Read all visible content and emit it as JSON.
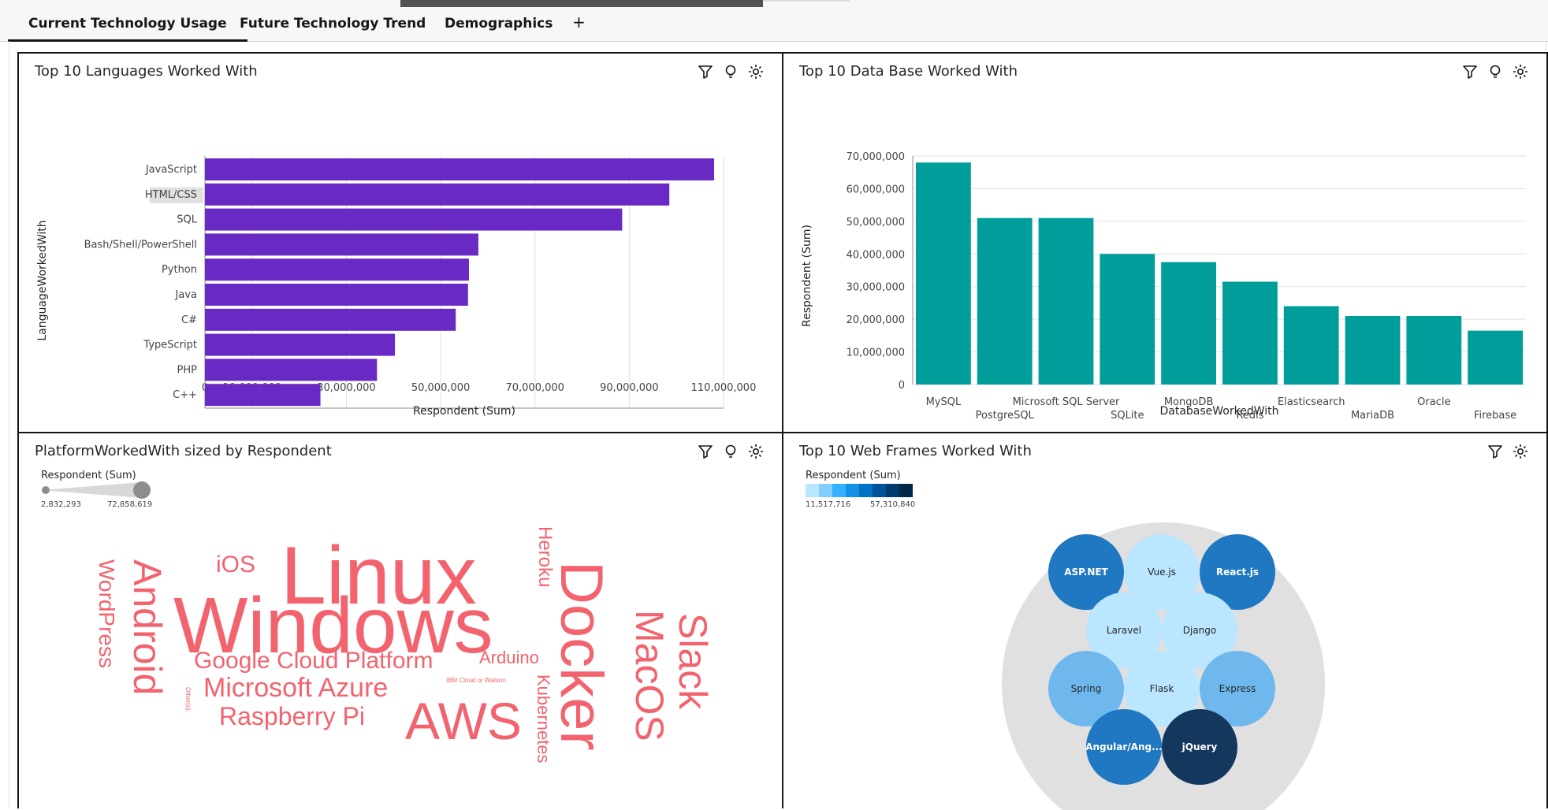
{
  "tabs": [
    {
      "label": "Current Technology Usage",
      "active": true
    },
    {
      "label": "Future Technology Trend",
      "active": false
    },
    {
      "label": "Demographics",
      "active": false
    }
  ],
  "add_tab_label": "+",
  "panels": {
    "languages": {
      "title": "Top 10 Languages Worked With"
    },
    "databases": {
      "title": "Top 10 Data Base Worked With"
    },
    "platforms": {
      "title": "PlatformWorkedWith sized by Respondent"
    },
    "webframes": {
      "title": "Top 10 Web Frames Worked With"
    }
  },
  "colors": {
    "bar_purple": "#6929c4",
    "bar_teal": "#009d9a",
    "wordcloud": "#f2636e"
  },
  "chart_data": [
    {
      "id": "languages",
      "type": "bar",
      "orientation": "horizontal",
      "title": "Top 10 Languages Worked With",
      "xlabel": "Respondent (Sum)",
      "ylabel": "LanguageWorkedWith",
      "categories": [
        "JavaScript",
        "HTML/CSS",
        "SQL",
        "Bash/Shell/PowerShell",
        "Python",
        "Java",
        "C#",
        "TypeScript",
        "PHP",
        "C++"
      ],
      "values": [
        108000000,
        98500000,
        88500000,
        58000000,
        56000000,
        55800000,
        53200000,
        40300000,
        36500000,
        24500000
      ],
      "xticks": [
        "0",
        "10,000,000",
        "30,000,000",
        "50,000,000",
        "70,000,000",
        "90,000,000",
        "110,000,000"
      ],
      "xtick_values": [
        0,
        10000000,
        30000000,
        50000000,
        70000000,
        90000000,
        110000000
      ],
      "xlim": [
        0,
        110000000
      ],
      "highlighted_category": "HTML/CSS",
      "grid": true
    },
    {
      "id": "databases",
      "type": "bar",
      "orientation": "vertical",
      "title": "Top 10 Data Base Worked With",
      "xlabel": "DatabaseWorkedWith",
      "ylabel": "Respondent (Sum)",
      "categories": [
        "MySQL",
        "PostgreSQL",
        "Microsoft SQL Server",
        "SQLite",
        "MongoDB",
        "Redis",
        "Elasticsearch",
        "MariaDB",
        "Oracle",
        "Firebase"
      ],
      "values": [
        68000000,
        51000000,
        51000000,
        40000000,
        37500000,
        31500000,
        24000000,
        21000000,
        21000000,
        16500000
      ],
      "yticks": [
        "0",
        "10,000,000",
        "20,000,000",
        "30,000,000",
        "40,000,000",
        "50,000,000",
        "60,000,000",
        "70,000,000"
      ],
      "ytick_values": [
        0,
        10000000,
        20000000,
        30000000,
        40000000,
        50000000,
        60000000,
        70000000
      ],
      "ylim": [
        0,
        70000000
      ],
      "grid": true
    },
    {
      "id": "platforms",
      "type": "wordcloud",
      "title": "PlatformWorkedWith sized by Respondent",
      "legend": {
        "title": "Respondent (Sum)",
        "min_label": "2,832,293",
        "max_label": "72,858,619"
      },
      "words": [
        {
          "text": "Linux",
          "value": 66000000
        },
        {
          "text": "Windows",
          "value": 72858619
        },
        {
          "text": "Docker",
          "value": 48000000
        },
        {
          "text": "AWS",
          "value": 38000000
        },
        {
          "text": "Android",
          "value": 30000000
        },
        {
          "text": "MacOS",
          "value": 29000000
        },
        {
          "text": "Slack",
          "value": 27000000
        },
        {
          "text": "Google Cloud Platform",
          "value": 20000000
        },
        {
          "text": "Microsoft Azure",
          "value": 20000000
        },
        {
          "text": "Raspberry Pi",
          "value": 18000000
        },
        {
          "text": "WordPress",
          "value": 16000000
        },
        {
          "text": "Heroku",
          "value": 14000000
        },
        {
          "text": "Kubernetes",
          "value": 13000000
        },
        {
          "text": "iOS",
          "value": 15000000
        },
        {
          "text": "Arduino",
          "value": 12000000
        },
        {
          "text": "IBM Cloud or Watson",
          "value": 2900000
        },
        {
          "text": "Other(s):",
          "value": 2832293
        }
      ]
    },
    {
      "id": "webframes",
      "type": "packed-bubble",
      "title": "Top 10 Web Frames Worked With",
      "legend": {
        "title": "Respondent (Sum)",
        "min_label": "11,517,716",
        "max_label": "57,310,840",
        "colors": [
          "#bae6ff",
          "#82cfff",
          "#33b1ff",
          "#1192e8",
          "#0072c3",
          "#00539a",
          "#003a6d",
          "#012749"
        ]
      },
      "bubbles": [
        {
          "label": "ASP.NET",
          "color": "#1f78c1"
        },
        {
          "label": "Vue.js",
          "color": "#bae6ff"
        },
        {
          "label": "React.js",
          "color": "#1f78c1"
        },
        {
          "label": "Laravel",
          "color": "#bae6ff"
        },
        {
          "label": "Django",
          "color": "#bae6ff"
        },
        {
          "label": "Spring",
          "color": "#6fb8ee"
        },
        {
          "label": "Flask",
          "color": "#bae6ff"
        },
        {
          "label": "Express",
          "color": "#6fb8ee"
        },
        {
          "label": "Angular/Ang...",
          "color": "#1f78c1"
        },
        {
          "label": "jQuery",
          "color": "#14375e"
        }
      ]
    }
  ]
}
